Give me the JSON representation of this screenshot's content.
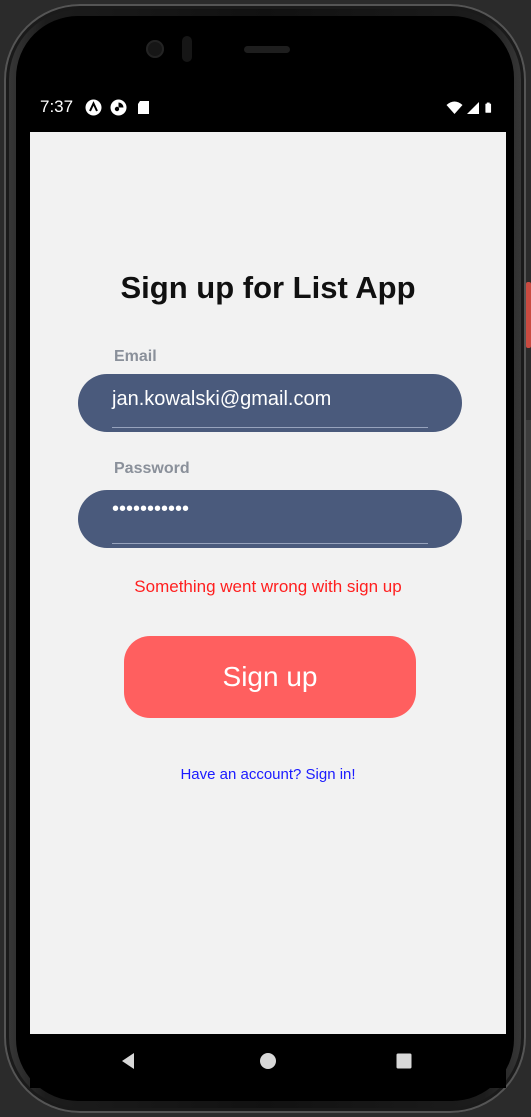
{
  "status_bar": {
    "time": "7:37",
    "left_icons": [
      "android-a-icon",
      "circle-notification-icon",
      "sd-card-icon"
    ],
    "right_icons": [
      "wifi-icon",
      "cell-signal-icon",
      "battery-icon"
    ]
  },
  "signup_screen": {
    "title": "Sign up for List App",
    "email": {
      "label": "Email",
      "value": "jan.kowalski@gmail.com"
    },
    "password": {
      "label": "Password",
      "masked_value": "•••••••••••"
    },
    "error_message": "Something went wrong with sign up",
    "signup_button_label": "Sign up",
    "signin_link": "Have an account? Sign in!"
  },
  "nav_bar": {
    "buttons": [
      "back-icon",
      "home-icon",
      "recents-icon"
    ]
  },
  "colors": {
    "background": "#f2f2f2",
    "field_fill": "#4a5a7c",
    "button_fill": "#ff5f5f",
    "error_text": "#ff1f1f",
    "link_text": "#1a1aff"
  }
}
